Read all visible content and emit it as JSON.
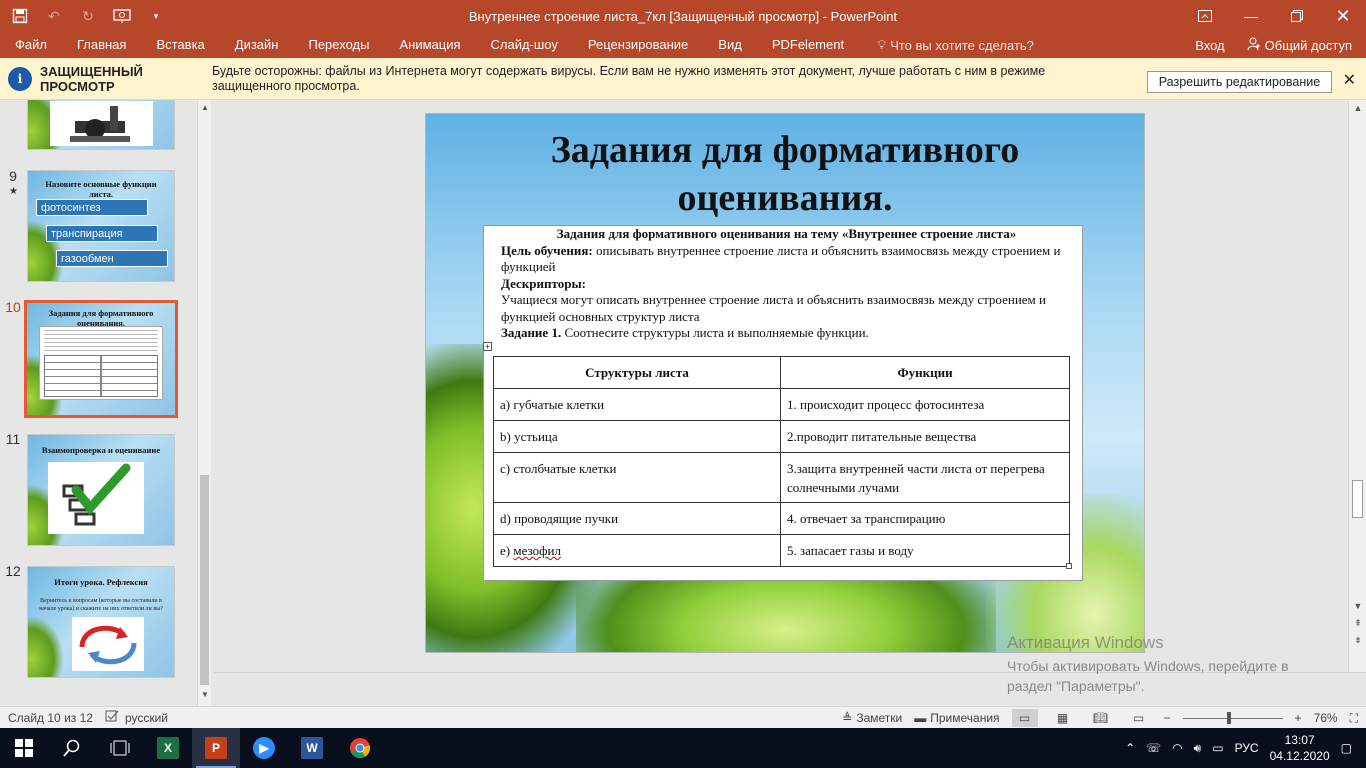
{
  "window": {
    "title": "Внутреннее строение листа_7кл [Защищенный просмотр] - PowerPoint"
  },
  "ribbon": {
    "tabs": [
      "Файл",
      "Главная",
      "Вставка",
      "Дизайн",
      "Переходы",
      "Анимация",
      "Слайд-шоу",
      "Рецензирование",
      "Вид",
      "PDFelement"
    ],
    "tell_me": "Что вы хотите сделать?",
    "signin": "Вход",
    "share": "Общий доступ"
  },
  "protected_view": {
    "label": "ЗАЩИЩЕННЫЙ ПРОСМОТР",
    "message": "Будьте осторожны: файлы из Интернета могут содержать вирусы. Если вам не нужно изменять этот документ, лучше работать с ним в режиме защищенного просмотра.",
    "enable_button": "Разрешить редактирование"
  },
  "thumbnails": {
    "slide9": {
      "number": "9",
      "title": "Назовите основные функции листа.",
      "boxes": [
        "фотосинтез",
        "транспирация",
        "газообмен"
      ]
    },
    "slide10": {
      "number": "10",
      "title": "Задания для формативного оценивания."
    },
    "slide11": {
      "number": "11",
      "title": "Взаимопроверка и оценивание"
    },
    "slide12": {
      "number": "12",
      "title": "Итоги урока. Рефлексия",
      "body": "Вернитесь к вопросам (которые вы составили в начале урока) и скажите на них ответили ли вы?"
    }
  },
  "slide": {
    "title": "Задания для формативного оценивания.",
    "heading": "Задания для формативного оценивания на тему «Внутреннее строение листа»",
    "goal_label": "Цель обучения:",
    "goal_text": " описывать внутреннее строение листа и объяснить взаимосвязь между строением и функцией",
    "descriptors_label": "Дескрипторы:",
    "descriptors_text": "Учащиеся могут описать внутреннее строение листа и объяснить взаимосвязь между строением и функцией основных структур листа",
    "task_label": "Задание 1.",
    "task_text": " Соотнесите структуры листа и выполняемые функции.",
    "table": {
      "headers": [
        "Структуры листа",
        "Функции"
      ],
      "rows": [
        [
          "a) губчатые клетки",
          "1. происходит процесс фотосинтеза"
        ],
        [
          "b) устьица",
          "2.проводит питательные вещества"
        ],
        [
          "c) столбчатые клетки",
          "3.защита внутренней части листа от перегрева солнечными лучами"
        ],
        [
          "d) проводящие пучки",
          "4. отвечает за транспирацию"
        ],
        [
          "e) мезофил",
          "5. запасает газы и воду"
        ]
      ],
      "last_row_prefix": "e) ",
      "last_row_word": "мезофил"
    }
  },
  "watermark": {
    "line1": "Активация Windows",
    "line2": "Чтобы активировать Windows, перейдите в раздел \"Параметры\"."
  },
  "statusbar": {
    "slide_count": "Слайд 10 из 12",
    "language": "русский",
    "notes": "Заметки",
    "comments": "Примечания",
    "zoom": "76%"
  },
  "taskbar": {
    "language": "РУС",
    "time": "13:07",
    "date": "04.12.2020"
  },
  "colors": {
    "accent": "#b7472a",
    "selected_thumb": "#e15b35",
    "protected_bar": "#fff4ce"
  }
}
